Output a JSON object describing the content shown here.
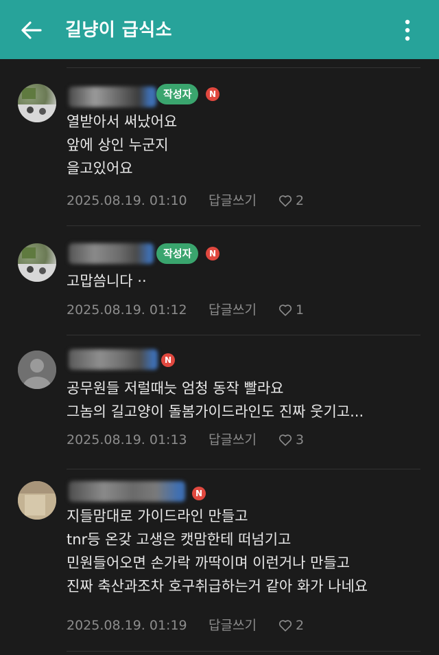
{
  "header": {
    "title": "길냥이 급식소"
  },
  "colors": {
    "header_bg": "#27a39a",
    "background": "#1b1b1b",
    "author_badge": "#3aa56e",
    "new_badge": "#e0483f"
  },
  "labels": {
    "author_badge": "작성자",
    "new_badge": "N",
    "reply": "답글쓰기"
  },
  "comments": [
    {
      "is_author": true,
      "lines": [
        "열받아서 써났어요",
        "앞에 상인 누군지",
        "을고있어요"
      ],
      "date": "2025.08.19. 01:10",
      "likes": "2"
    },
    {
      "is_author": true,
      "lines": [
        "고맙씀니다 ··"
      ],
      "date": "2025.08.19. 01:12",
      "likes": "1"
    },
    {
      "is_author": false,
      "lines": [
        "공무원들 저럴때늣 엄청 동작 빨라요",
        "그놈의 길고양이 돌봄가이드라인도 진짜 웃기고..."
      ],
      "date": "2025.08.19. 01:13",
      "likes": "3"
    },
    {
      "is_author": false,
      "lines": [
        "지들맘대로 가이드라인 만들고",
        "tnr등 온갖 고생은 캣맘한테 떠넘기고",
        "민원들어오면 손가락 까딱이며 이런거나 만들고",
        "진짜 축산과조차 호구취급하는거 같아 화가 나네요"
      ],
      "date": "2025.08.19. 01:19",
      "likes": "2"
    }
  ]
}
